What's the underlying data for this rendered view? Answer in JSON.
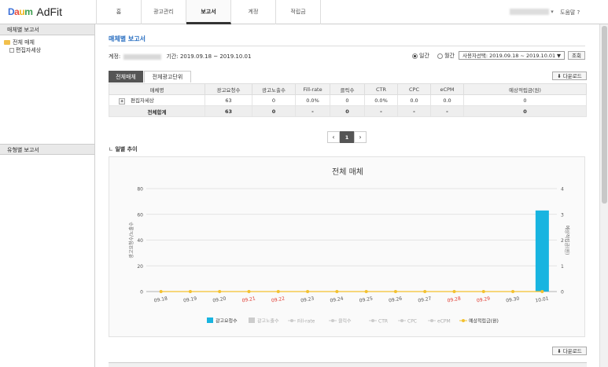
{
  "brand": {
    "daum": "Daum",
    "product": "AdFit"
  },
  "nav": {
    "items": [
      {
        "label": "홈"
      },
      {
        "label": "광고관리"
      },
      {
        "label": "보고서"
      },
      {
        "label": "계정"
      },
      {
        "label": "적립금"
      }
    ],
    "active": 2
  },
  "header": {
    "help": "도움말 ?"
  },
  "sidebar": {
    "section1": "매체별 보고서",
    "tree_root": "전체 매체",
    "tree_child": "편집자세상",
    "section2": "유형별 보고서"
  },
  "page": {
    "title": "매체별 보고서",
    "account_label": "계정:",
    "period_label": "기간: 2019.09.18 ~ 2019.10.01",
    "radio_daily": "일간",
    "radio_monthly": "월간",
    "date_select": "사용자선택: 2019.09.18 ~ 2019.10.01",
    "search_button": "조회",
    "download_button": "다운로드",
    "tabs": [
      {
        "label": "전체매체"
      },
      {
        "label": "전체광고단위"
      }
    ],
    "table": {
      "headers": [
        "매체명",
        "광고요청수",
        "광고노출수",
        "Fill-rate",
        "클릭수",
        "CTR",
        "CPC",
        "eCPM",
        "예상적립금(원)"
      ],
      "rows": [
        {
          "icon": "a",
          "cells": [
            "편집자세상",
            "63",
            "0",
            "0.0%",
            "0",
            "0.0%",
            "0.0",
            "0.0",
            "0"
          ]
        }
      ],
      "total": [
        "전체합계",
        "63",
        "0",
        "-",
        "0",
        "-",
        "-",
        "-",
        "0"
      ]
    },
    "pagination": {
      "prev": "‹",
      "current": "1",
      "next": "›"
    },
    "section_title": "일별 추이"
  },
  "chart_data": {
    "type": "bar",
    "title": "전체 매체",
    "categories": [
      "09.18",
      "09.19",
      "09.20",
      "09.21",
      "09.22",
      "09.23",
      "09.24",
      "09.25",
      "09.26",
      "09.27",
      "09.28",
      "09.29",
      "09.30",
      "10.01"
    ],
    "weekend_categories": [
      "09.21",
      "09.22",
      "09.28",
      "09.29"
    ],
    "ylabel": "광고요청수/노출수",
    "y2label": "예상적립금(원)",
    "ylim": [
      0,
      80
    ],
    "y2lim": [
      0,
      4
    ],
    "yticks": [
      0,
      20,
      40,
      60,
      80
    ],
    "y2ticks": [
      0,
      1,
      2,
      3,
      4
    ],
    "series": [
      {
        "name": "광고요청수",
        "type": "bar",
        "color": "#18b4e0",
        "values": [
          0,
          0,
          0,
          0,
          0,
          0,
          0,
          0,
          0,
          0,
          0,
          0,
          0,
          63
        ]
      },
      {
        "name": "광고노출수",
        "type": "bar",
        "color": "#cccccc",
        "values": [
          0,
          0,
          0,
          0,
          0,
          0,
          0,
          0,
          0,
          0,
          0,
          0,
          0,
          0
        ]
      },
      {
        "name": "Fill-rate",
        "type": "line",
        "color": "#cccccc",
        "values": [
          0,
          0,
          0,
          0,
          0,
          0,
          0,
          0,
          0,
          0,
          0,
          0,
          0,
          0
        ]
      },
      {
        "name": "클릭수",
        "type": "line",
        "color": "#cccccc",
        "values": [
          0,
          0,
          0,
          0,
          0,
          0,
          0,
          0,
          0,
          0,
          0,
          0,
          0,
          0
        ]
      },
      {
        "name": "CTR",
        "type": "line",
        "color": "#cccccc",
        "values": [
          0,
          0,
          0,
          0,
          0,
          0,
          0,
          0,
          0,
          0,
          0,
          0,
          0,
          0
        ]
      },
      {
        "name": "CPC",
        "type": "line",
        "color": "#cccccc",
        "values": [
          0,
          0,
          0,
          0,
          0,
          0,
          0,
          0,
          0,
          0,
          0,
          0,
          0,
          0
        ]
      },
      {
        "name": "eCPM",
        "type": "line",
        "color": "#cccccc",
        "values": [
          0,
          0,
          0,
          0,
          0,
          0,
          0,
          0,
          0,
          0,
          0,
          0,
          0,
          0
        ]
      },
      {
        "name": "예상적립금(원)",
        "type": "line",
        "color": "#f3c12f",
        "values": [
          0,
          0,
          0,
          0,
          0,
          0,
          0,
          0,
          0,
          0,
          0,
          0,
          0,
          0
        ]
      }
    ],
    "legend_position": "bottom",
    "grid": true
  }
}
